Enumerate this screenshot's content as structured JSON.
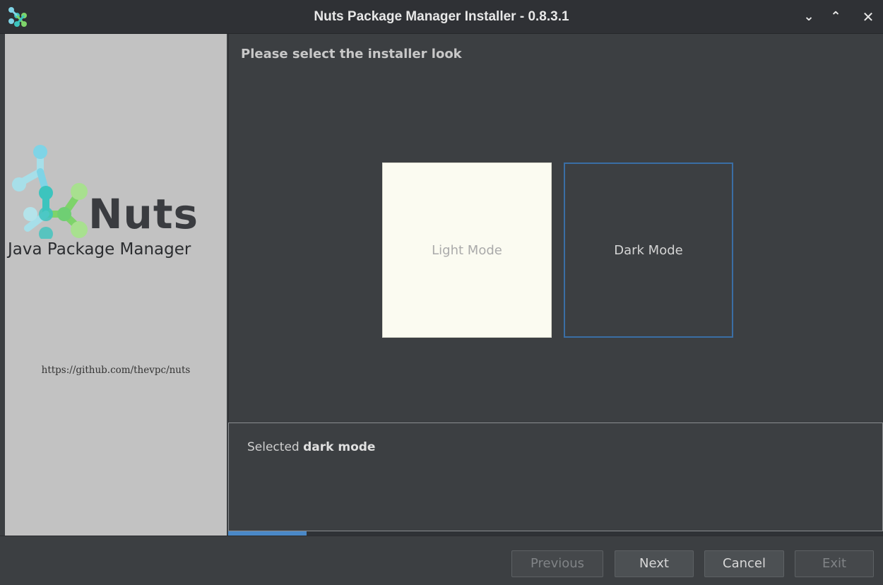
{
  "window": {
    "title": "Nuts Package Manager Installer - 0.8.3.1",
    "controls": {
      "minimize": "⌄",
      "maximize": "⌃",
      "close": "✕"
    }
  },
  "sidebar": {
    "logo_name": "Nuts",
    "logo_subtitle": "Java Package Manager",
    "url": "https://github.com/thevpc/nuts"
  },
  "content": {
    "title": "Please select the installer look",
    "modes": [
      {
        "label": "Light Mode",
        "selected": false
      },
      {
        "label": "Dark Mode",
        "selected": true
      }
    ]
  },
  "message": {
    "prefix": "Selected",
    "emphasis": "dark mode"
  },
  "progress": {
    "fraction": 0.12
  },
  "footer": {
    "previous": "Previous",
    "next": "Next",
    "cancel": "Cancel",
    "exit": "Exit"
  },
  "colors": {
    "accent": "#3a6ea5",
    "progress": "#4a88c7",
    "logo_teal": "#3cc4be",
    "logo_green": "#7ed36a",
    "logo_cyan": "#7fd4e6"
  }
}
